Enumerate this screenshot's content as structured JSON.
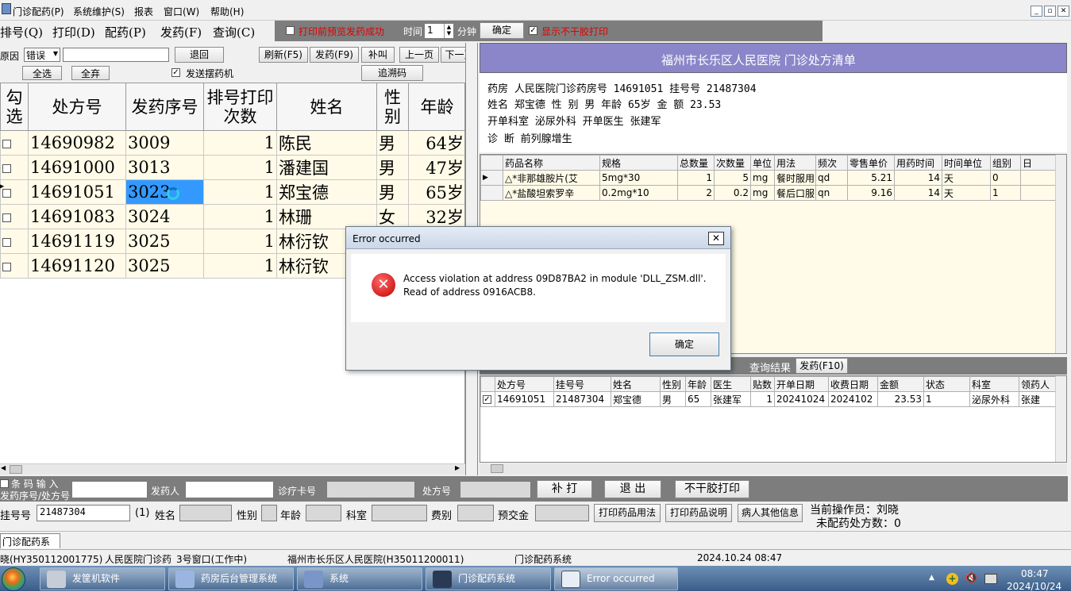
{
  "menu": [
    "门诊配药(P)",
    "系统维护(S)",
    "报表",
    "窗口(W)",
    "帮助(H)"
  ],
  "toolbar": {
    "queue": "排号(Q)",
    "print": "打印(D)",
    "dispense_cfg": "配药(P)",
    "dispense": "发药(F)",
    "query": "查询(C)",
    "print_preview_label": "打印前预览发药成功",
    "interval_label": "时间",
    "interval_value": "1",
    "minutes_label": "分钟",
    "confirm": "确定",
    "show_no_print_label": "显示不干胶打印"
  },
  "left": {
    "reason_label": "原因",
    "reason_value": "错误",
    "return_btn": "退回",
    "refresh_btn": "刷新(F5)",
    "dispense_btn": "发药(F9)",
    "call_btn": "补叫",
    "prev_btn": "上一页",
    "next_btn": "下一页",
    "select_all": "全选",
    "deselect_all": "全弃",
    "send_machine": "发送摆药机",
    "trace_btn": "追溯码",
    "headers": [
      "勾选",
      "处方号",
      "发药序号",
      "排号打印次数",
      "姓名",
      "性别",
      "年龄"
    ],
    "rows": [
      {
        "rx": "14690982",
        "seq": "3009",
        "count": "1",
        "name": "陈民",
        "sex": "男",
        "age": "64岁"
      },
      {
        "rx": "14691000",
        "seq": "3013",
        "count": "1",
        "name": "潘建国",
        "sex": "男",
        "age": "47岁"
      },
      {
        "rx": "14691051",
        "seq": "3023",
        "count": "1",
        "name": "郑宝德",
        "sex": "男",
        "age": "65岁"
      },
      {
        "rx": "14691083",
        "seq": "3024",
        "count": "1",
        "name": "林珊",
        "sex": "女",
        "age": "32岁"
      },
      {
        "rx": "14691119",
        "seq": "3025",
        "count": "1",
        "name": "林衍钦",
        "sex": "",
        "age": ""
      },
      {
        "rx": "14691120",
        "seq": "3025",
        "count": "1",
        "name": "林衍钦",
        "sex": "",
        "age": ""
      }
    ]
  },
  "rx": {
    "title": "福州市长乐区人民医院    门诊处方清单",
    "line1": "药房 人民医院门诊药房号 14691051        挂号号 21487304",
    "line2": "姓名 郑宝德      性  别 男    年龄 65岁  金  额 23.53",
    "line3": "开单科室 泌尿外科         开单医生 张建军",
    "line4": "诊  断  前列腺增生",
    "detail_headers": [
      "药品名称",
      "规格",
      "总数量",
      "次数量",
      "单位",
      "用法",
      "频次",
      "零售单价",
      "用药时间",
      "时间单位",
      "组别",
      "日"
    ],
    "detail_rows": [
      [
        "△*非那雄胺片(艾",
        "5mg*30",
        "1",
        "5",
        "mg",
        "餐时服用",
        "qd",
        "5.21",
        "14",
        "天",
        "0",
        ""
      ],
      [
        "△*盐酸坦索罗辛",
        "0.2mg*10",
        "2",
        "0.2",
        "mg",
        "餐后口服",
        "qn",
        "9.16",
        "14",
        "天",
        "1",
        ""
      ]
    ]
  },
  "result": {
    "title": "查询结果",
    "dispense_btn": "发药(F10)",
    "headers": [
      "处方号",
      "挂号号",
      "姓名",
      "性别",
      "年龄",
      "医生",
      "贴数",
      "开单日期",
      "收费日期",
      "金额",
      "状态",
      "科室",
      "领药人"
    ],
    "rows": [
      [
        "14691051",
        "21487304",
        "郑宝德",
        "男",
        "65",
        "张建军",
        "1",
        "20241024",
        "2024102",
        "23.53",
        "1",
        "泌尿外科",
        "张建"
      ]
    ]
  },
  "dialog": {
    "title": "Error occurred",
    "message1": "Access violation at address 09D87BA2 in module 'DLL_ZSM.dll'.",
    "message2": "Read of address 0916ACB8.",
    "ok": "确定"
  },
  "bottom": {
    "barcode_label": "条 码 输 入",
    "seq_label": "发药序号/处方号",
    "dispenser_label": "发药人",
    "card_label": "诊疗卡号",
    "rxno_label": "处方号",
    "reprint": "补 打",
    "exit": "退 出",
    "no_label_print": "不干胶打印",
    "reg_label": "挂号号",
    "reg_value": "21487304",
    "one_label": "(1)",
    "name_label": "姓名",
    "sex_label": "性别",
    "age_label": "年龄",
    "dept_label": "科室",
    "fee_label": "费别",
    "prepay_label": "预交金",
    "print_usage": "打印药品用法",
    "print_desc": "打印药品说明",
    "patient_info": "病人其他信息",
    "operator": "当前操作员：刘晓",
    "pending": "未配药处方数：0"
  },
  "window_tab": "门诊配药系统",
  "status": [
    "晓(HY350112001775)",
    "人民医院门诊药",
    "3号窗口(工作中)",
    "福州市长乐区人民医院(H35011200011)",
    "门诊配药系统",
    "2024.10.24 08:47"
  ],
  "taskbar": {
    "tasks": [
      "发筐机软件",
      "药房后台管理系统",
      "系统",
      "门诊配药系统",
      "Error occurred"
    ],
    "time": "08:47",
    "date": "2024/10/24"
  },
  "colors": {
    "header_purple": "#8b86c9",
    "list_bg": "#fffbe8",
    "selection": "#3399ff",
    "taskbar": "#4a6d97"
  }
}
